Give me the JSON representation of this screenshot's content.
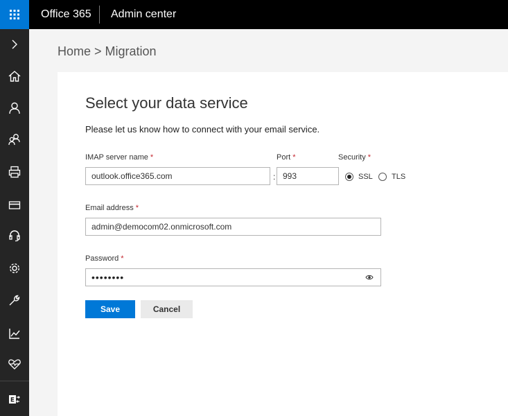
{
  "header": {
    "app_name": "Office 365",
    "section_name": "Admin center",
    "waffle_icon": "app-launcher-icon"
  },
  "rail": {
    "items": [
      {
        "name": "expand",
        "icon": "chevron-right-icon"
      },
      {
        "name": "home",
        "icon": "home-icon"
      },
      {
        "name": "users",
        "icon": "user-icon"
      },
      {
        "name": "groups",
        "icon": "group-icon"
      },
      {
        "name": "resources",
        "icon": "printer-icon"
      },
      {
        "name": "billing",
        "icon": "credit-card-icon"
      },
      {
        "name": "support",
        "icon": "headset-icon"
      },
      {
        "name": "settings",
        "icon": "gear-icon"
      },
      {
        "name": "setup",
        "icon": "wrench-icon"
      },
      {
        "name": "reports",
        "icon": "chart-icon"
      },
      {
        "name": "health",
        "icon": "heart-pulse-icon"
      },
      {
        "name": "exchange",
        "icon": "exchange-icon"
      }
    ]
  },
  "breadcrumb": "Home > Migration",
  "form": {
    "title": "Select your data service",
    "subtitle": "Please let us know how to connect with your email service.",
    "required_marker": "*",
    "imap": {
      "label": "IMAP server name",
      "value": "outlook.office365.com"
    },
    "port": {
      "label": "Port",
      "value": "993",
      "separator": ":"
    },
    "security": {
      "label": "Security",
      "options": [
        {
          "label": "SSL",
          "selected": true
        },
        {
          "label": "TLS",
          "selected": false
        }
      ]
    },
    "email": {
      "label": "Email address",
      "value": "admin@democom02.onmicrosoft.com"
    },
    "password": {
      "label": "Password",
      "masked_value": "••••••••",
      "reveal_icon": "eye-icon"
    },
    "save_label": "Save",
    "cancel_label": "Cancel"
  },
  "colors": {
    "accent": "#0078d7",
    "topbar": "#000000",
    "rail": "#252525",
    "required": "#c4262e"
  }
}
